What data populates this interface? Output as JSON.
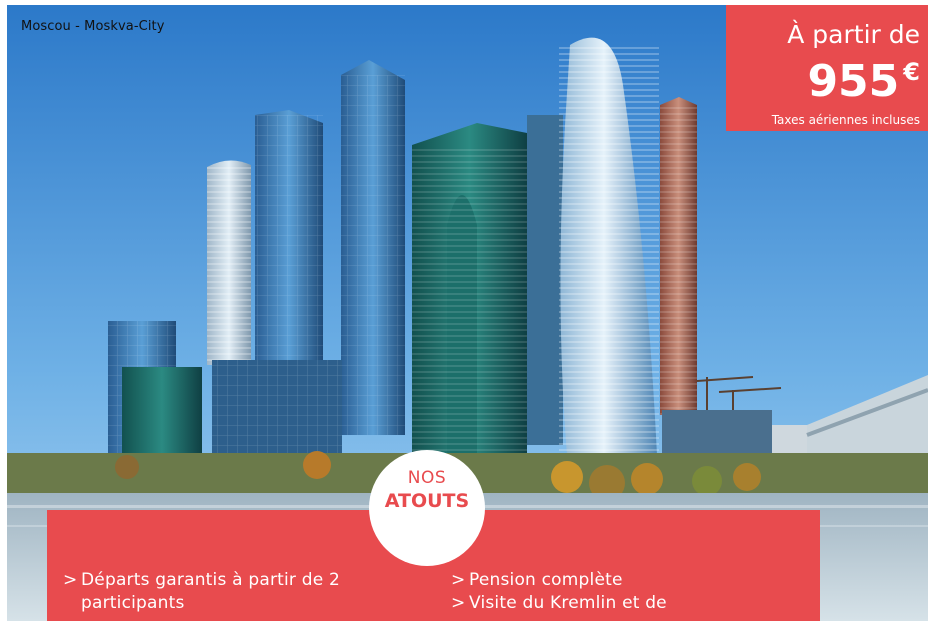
{
  "photo": {
    "caption": "Moscou - Moskva-City"
  },
  "price": {
    "prefix": "À partir de",
    "amount": "955",
    "currency": "€",
    "note": "Taxes aériennes incluses"
  },
  "highlights": {
    "heading_top": "NOS",
    "heading_bottom": "ATOUTS",
    "arrow": ">",
    "items_left": [
      "Départs garantis à partir de 2 participants"
    ],
    "items_right": [
      "Pension complète",
      "Visite du Kremlin et de"
    ]
  },
  "colors": {
    "accent": "#e84b4e",
    "sky_top": "#2c79c9",
    "sky_bottom": "#a9d3f2",
    "water": "#b8cbd5"
  }
}
